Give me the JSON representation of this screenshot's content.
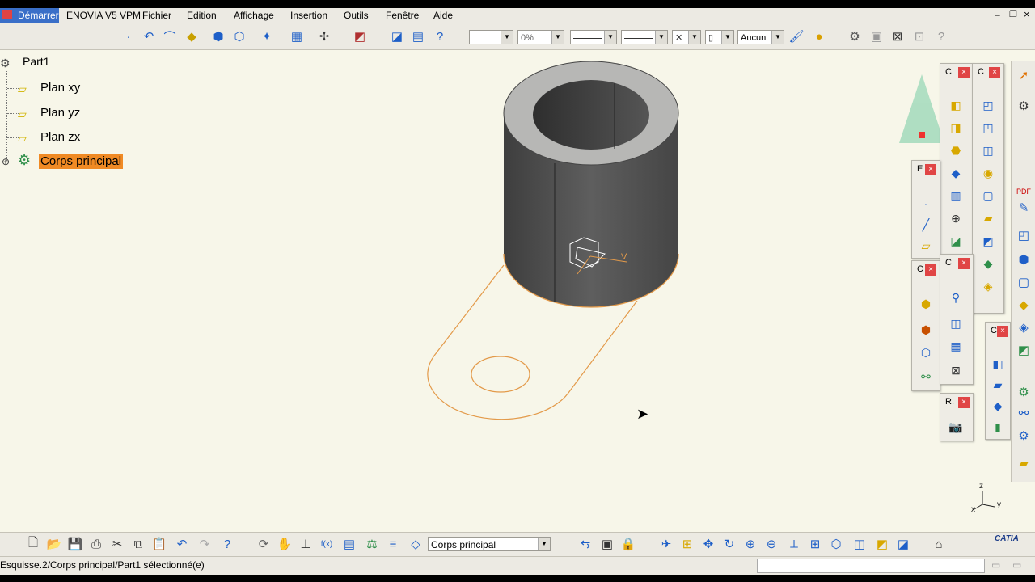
{
  "menu": {
    "start": "Démarrer",
    "items": [
      "ENOVIA V5 VPM",
      "Fichier",
      "Edition",
      "Affichage",
      "Insertion",
      "Outils",
      "Fenêtre",
      "Aide"
    ]
  },
  "toolbar": {
    "color_combo": "",
    "transparency_combo": "0%",
    "layer_combo": "Aucun"
  },
  "tree": {
    "root": "Part1",
    "items": [
      "Plan xy",
      "Plan yz",
      "Plan zx"
    ],
    "body": "Corps principal"
  },
  "palettes": [
    {
      "title": "C"
    },
    {
      "title": "C"
    },
    {
      "title": "E"
    },
    {
      "title": "C"
    },
    {
      "title": "C"
    },
    {
      "title": "C"
    },
    {
      "title": "R."
    }
  ],
  "axis": {
    "z": "z",
    "x": "x",
    "y": "y"
  },
  "sketch_axis_label": "V",
  "bottom_toolbar": {
    "work_object": "Corps principal"
  },
  "status": {
    "text": "Esquisse.2/Corps principal/Part1 sélectionné(e)"
  },
  "logo": "CATIA",
  "colors": {
    "selection": "#f08a24",
    "viewport": "#f7f6e9",
    "cylinder": "#5b5b5b",
    "sketch": "#e39a4a"
  }
}
